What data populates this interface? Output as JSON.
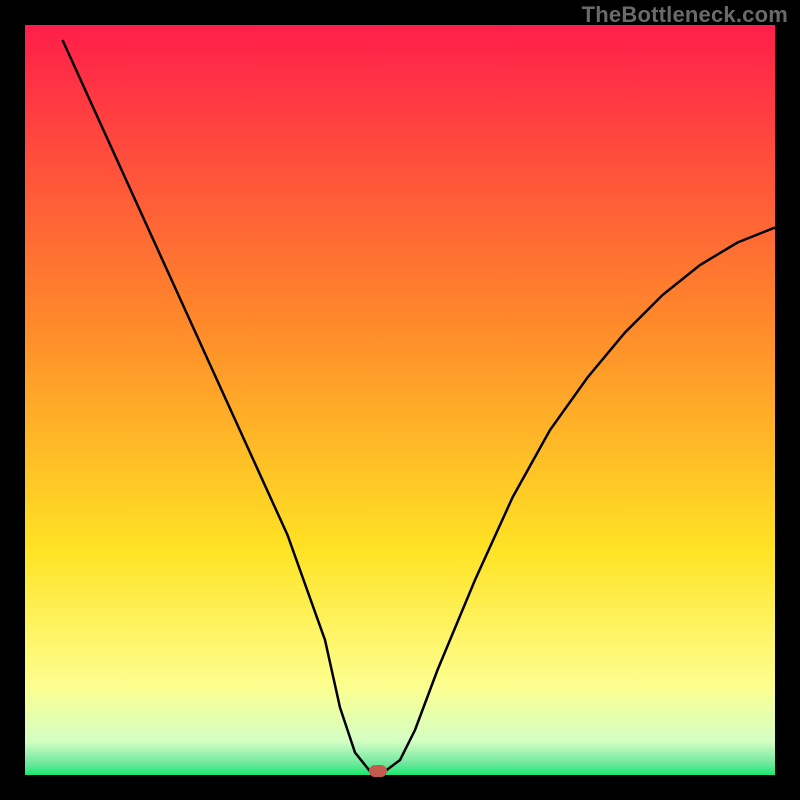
{
  "watermark": {
    "text": "TheBottleneck.com"
  },
  "chart_data": {
    "type": "line",
    "title": "",
    "xlabel": "",
    "ylabel": "",
    "xlim": [
      0,
      100
    ],
    "ylim": [
      0,
      100
    ],
    "grid": false,
    "legend": false,
    "series": [
      {
        "name": "bottleneck-curve",
        "x": [
          5,
          10,
          15,
          20,
          25,
          30,
          35,
          40,
          42,
          44,
          46,
          47,
          48,
          50,
          52,
          55,
          60,
          65,
          70,
          75,
          80,
          85,
          90,
          95,
          100
        ],
        "y": [
          98,
          87,
          76,
          65,
          54,
          43,
          32,
          18,
          9,
          3,
          0.5,
          0.5,
          0.5,
          2,
          6,
          14,
          26,
          37,
          46,
          53,
          59,
          64,
          68,
          71,
          73
        ]
      }
    ],
    "optimum_marker": {
      "x": 47,
      "y": 0.5,
      "color": "#c35a4d"
    },
    "background_gradient": {
      "stops": [
        {
          "pos": 0.0,
          "color": "#ff1e4a"
        },
        {
          "pos": 0.4,
          "color": "#ff8a2a"
        },
        {
          "pos": 0.7,
          "color": "#ffe324"
        },
        {
          "pos": 0.88,
          "color": "#fdff8e"
        },
        {
          "pos": 0.955,
          "color": "#d4ffc4"
        },
        {
          "pos": 0.985,
          "color": "#6de89e"
        },
        {
          "pos": 1.0,
          "color": "#17e86a"
        }
      ]
    }
  }
}
